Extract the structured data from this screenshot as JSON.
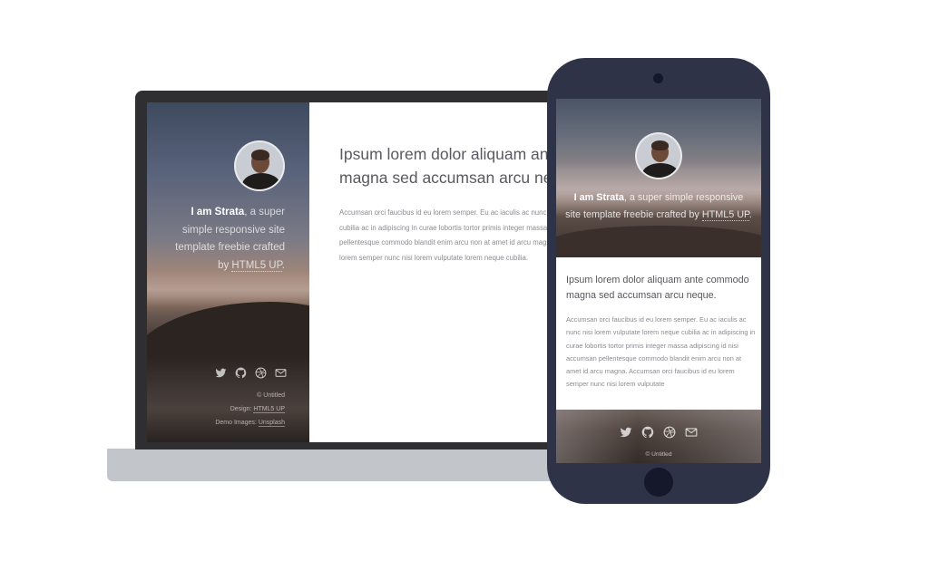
{
  "laptop": {
    "sidebar": {
      "intro": {
        "strong": "I am Strata",
        "text": ", a super simple responsive site template freebie crafted by ",
        "link": "HTML5 UP",
        "end": "."
      },
      "icons": [
        "twitter-icon",
        "github-icon",
        "dribbble-icon",
        "envelope-icon"
      ],
      "footer": {
        "copyright": "© Untitled",
        "design_label": "Design: ",
        "design_link": "HTML5 UP",
        "images_label": "Demo Images: ",
        "images_link": "Unsplash"
      }
    },
    "main": {
      "title_line1": "Ipsum lorem dolor aliquam ante commodo",
      "title_line2": "magna sed accumsan arcu neque.",
      "body_lines": [
        "Accumsan orci faucibus id eu lorem semper. Eu ac iaculis ac nunc nisi lorem vulputate lorem neque",
        "cubilia ac in adipiscing in curae lobortis tortor primis integer massa adipiscing id nisi accumsan",
        "pellentesque commodo blandit enim arcu non at amet id arcu magna. Accumsan orci faucibus id eu",
        "lorem semper nunc nisi lorem vulputate lorem neque cubilia."
      ]
    }
  },
  "phone": {
    "intro": {
      "strong": "I am Strata",
      "text": ", a super simple responsive site template freebie crafted by ",
      "link": "HTML5 UP",
      "end": "."
    },
    "title": "Ipsum lorem dolor aliquam ante commodo magna sed accumsan arcu neque.",
    "body": "Accumsan orci faucibus id eu lorem semper. Eu ac iaculis ac nunc nisi lorem vulputate lorem neque cubilia ac in adipiscing in curae lobortis tortor primis integer massa adipiscing id nisi accumsan pellentesque commodo blandit enim arcu non at amet id arcu magna. Accumsan orci faucibus id eu lorem semper nunc nisi lorem vulputate",
    "icons": [
      "twitter-icon",
      "github-icon",
      "dribbble-icon",
      "envelope-icon"
    ],
    "copyright": "© Untitled"
  },
  "colors": {
    "laptop_bezel": "#2f2f31",
    "laptop_base": "#c2c6cb",
    "phone_body": "#2e3347",
    "heading_text": "#585a60",
    "body_text": "#8a8c91"
  }
}
